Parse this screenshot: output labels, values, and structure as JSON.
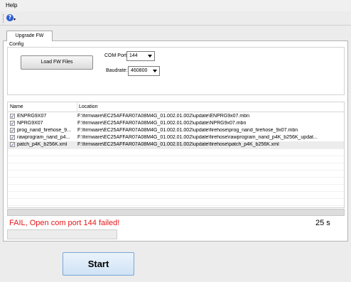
{
  "menu": {
    "help_label": "Help"
  },
  "toolbar": {
    "help_icon": "help-icon",
    "help_glyph": "?",
    "dropdown_glyph": "▾"
  },
  "tabs": [
    {
      "label": "Upgrade FW",
      "active": true
    }
  ],
  "config": {
    "group_title": "Config",
    "load_button_label": "Load FW Files",
    "com_port_label": "COM Port:",
    "com_port_value": "144",
    "baudrate_label": "Baudrate:",
    "baudrate_value": "460800"
  },
  "file_list": {
    "columns": [
      "Name",
      "Location"
    ],
    "rows": [
      {
        "checked": true,
        "name": "ENPRG9X07",
        "location": "F:\\firmware\\EC25AFFAR07A08M4G_01.002.01.002\\update\\ENPRG9x07.mbn"
      },
      {
        "checked": true,
        "name": "NPRG9X07",
        "location": "F:\\firmware\\EC25AFFAR07A08M4G_01.002.01.002\\update\\NPRG9x07.mbn"
      },
      {
        "checked": true,
        "name": "prog_nand_firehose_9...",
        "location": "F:\\firmware\\EC25AFFAR07A08M4G_01.002.01.002\\update\\firehose\\prog_nand_firehose_9x07.mbn"
      },
      {
        "checked": true,
        "name": "rawprogram_nand_p4...",
        "location": "F:\\firmware\\EC25AFFAR07A08M4G_01.002.01.002\\update\\firehose\\rawprogram_nand_p4K_b256K_updat..."
      },
      {
        "checked": true,
        "name": "patch_p4K_b256K.xml",
        "location": "F:\\firmware\\EC25AFFAR07A08M4G_01.002.01.002\\update\\firehose\\patch_p4K_b256K.xml",
        "selected": true
      }
    ]
  },
  "progress": {
    "value": 0
  },
  "status": {
    "message": "FAIL, Open com port 144 failed!",
    "elapsed": "25 s",
    "color": "#e4161a"
  },
  "actions": {
    "start_label": "Start"
  }
}
